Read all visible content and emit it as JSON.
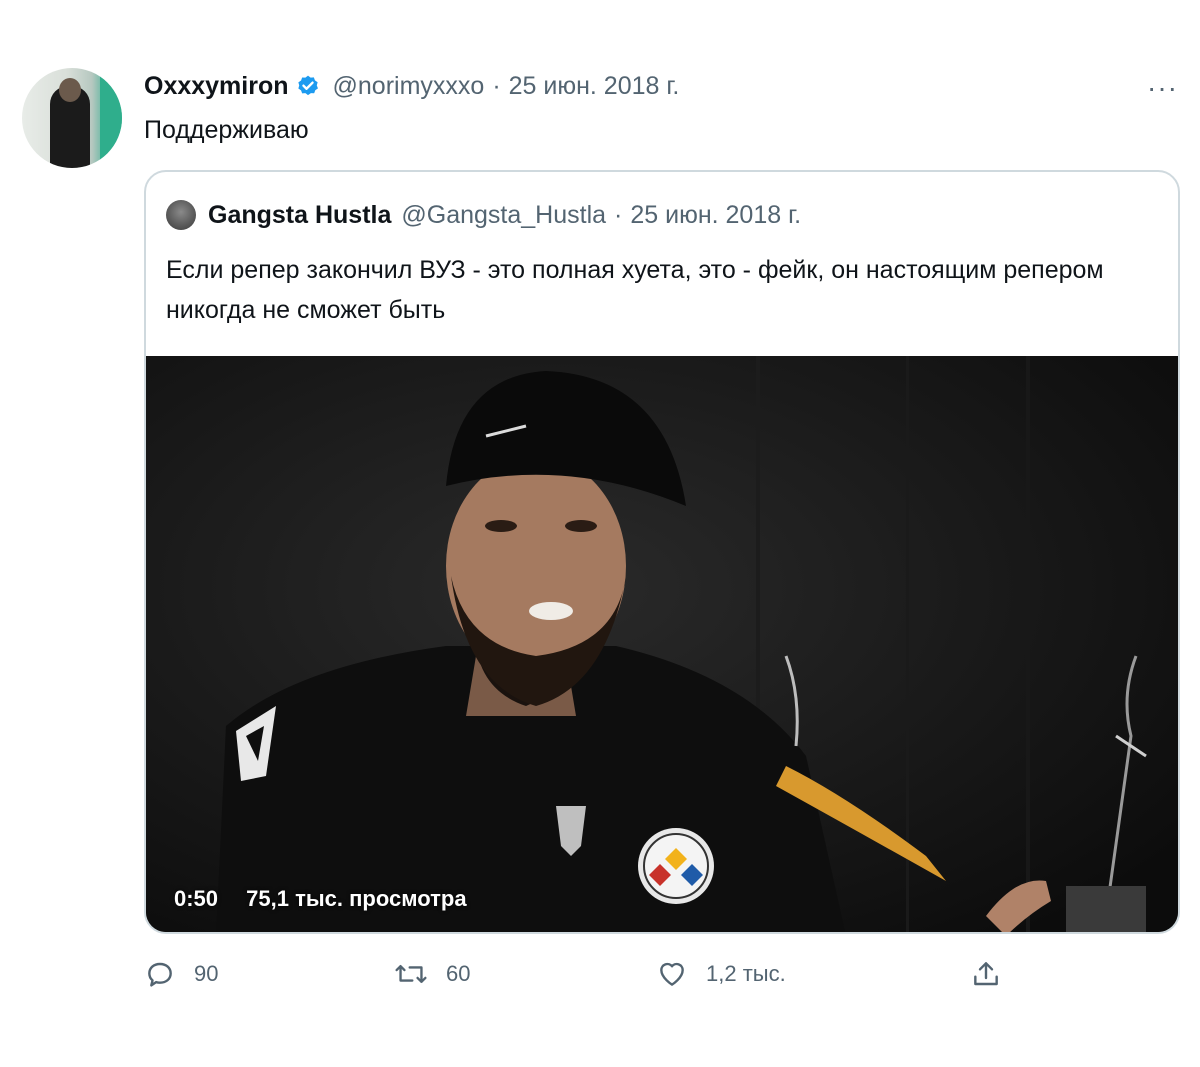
{
  "tweet": {
    "display_name": "Oxxxymiron",
    "handle": "@norimyxxxo",
    "separator": "·",
    "date": "25 июн. 2018 г.",
    "text": "Поддерживаю",
    "more_label": "···"
  },
  "quote": {
    "display_name": "Gangsta Hustla",
    "handle": "@Gangsta_Hustla",
    "separator": "·",
    "date": "25 июн. 2018 г.",
    "text": "Если репер закончил ВУЗ - это полная хуета, это - фейк, он настоящим репером никогда не сможет быть",
    "video": {
      "duration": "0:50",
      "views": "75,1 тыс. просмотра"
    }
  },
  "actions": {
    "replies": "90",
    "retweets": "60",
    "likes": "1,2 тыс."
  },
  "icons": {
    "verified": "verified-badge-icon",
    "reply": "reply-icon",
    "retweet": "retweet-icon",
    "like": "heart-icon",
    "share": "share-icon",
    "more": "more-icon"
  },
  "colors": {
    "verified": "#1d9bf0",
    "secondary_text": "#536471",
    "border": "#cfd9de"
  }
}
